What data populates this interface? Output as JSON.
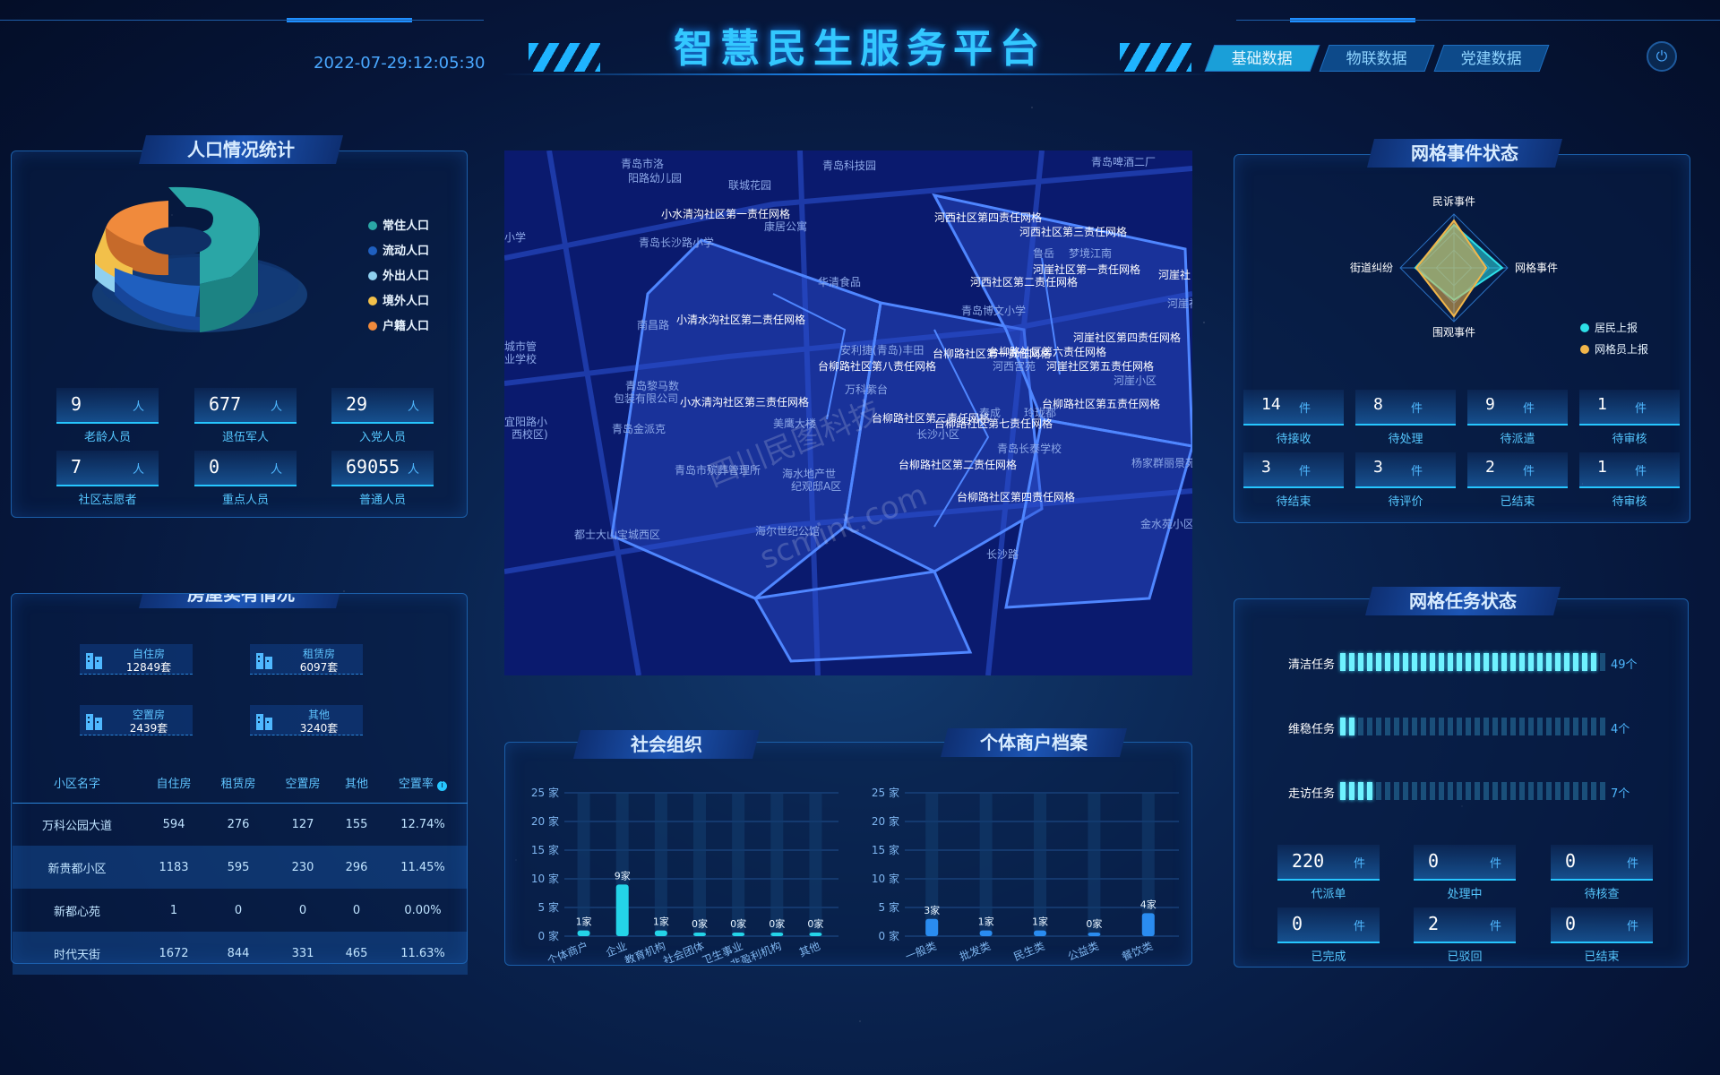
{
  "header": {
    "title": "智慧民生服务平台",
    "datetime": "2022-07-29:12:05:30",
    "tabs": [
      "基础数据",
      "物联数据",
      "党建数据"
    ],
    "power_icon": "power-icon"
  },
  "population": {
    "title": "人口情况统计",
    "legend": [
      {
        "label": "常住人口",
        "color": "#2aa6a6"
      },
      {
        "label": "流动人口",
        "color": "#1f5fbf"
      },
      {
        "label": "外出人口",
        "color": "#8fd0f0"
      },
      {
        "label": "境外人口",
        "color": "#f2c04a"
      },
      {
        "label": "户籍人口",
        "color": "#f08a3c"
      }
    ],
    "stats": [
      {
        "value": "9",
        "unit": "人",
        "label": "老龄人员"
      },
      {
        "value": "677",
        "unit": "人",
        "label": "退伍军人"
      },
      {
        "value": "29",
        "unit": "人",
        "label": "入党人员"
      },
      {
        "value": "7",
        "unit": "人",
        "label": "社区志愿者"
      },
      {
        "value": "0",
        "unit": "人",
        "label": "重点人员"
      },
      {
        "value": "69055",
        "unit": "人",
        "label": "普通人员"
      }
    ]
  },
  "housing": {
    "title": "房屋实有情况",
    "cards": [
      {
        "label": "自住房",
        "value": "12849套"
      },
      {
        "label": "租赁房",
        "value": "6097套"
      },
      {
        "label": "空置房",
        "value": "2439套"
      },
      {
        "label": "其他",
        "value": "3240套"
      }
    ],
    "table": {
      "headers": [
        "小区名字",
        "自住房",
        "租赁房",
        "空置房",
        "其他",
        "空置率"
      ],
      "rows": [
        [
          "万科公园大道",
          "594",
          "276",
          "127",
          "155",
          "12.74%"
        ],
        [
          "新贵都小区",
          "1183",
          "595",
          "230",
          "296",
          "11.45%"
        ],
        [
          "新都心苑",
          "1",
          "0",
          "0",
          "0",
          "0.00%"
        ],
        [
          "时代天街",
          "1672",
          "844",
          "331",
          "465",
          "11.63%"
        ]
      ]
    }
  },
  "map": {
    "labels": [
      "青岛市洛",
      "阳路幼儿园",
      "青岛科技园",
      "青岛啤酒二厂",
      "联城花园",
      "小水清沟社区第一责任网格",
      "康居公寓",
      "河西社区第四责任网格",
      "河西社区第三责任网格",
      "小学",
      "青岛长沙路小学",
      "鲁岳",
      "梦境江南",
      "河崖社区第一责任网格",
      "河崖社",
      "华清食品",
      "河西社区第二责任网格",
      "南昌路",
      "小清水沟社区第二责任网格",
      "青岛博文小学",
      "河崖社区",
      "城市管",
      "业学校",
      "台柳路社区第一责任网格",
      "台柳路社区第六责任网格",
      "河崖社区第四责任网格",
      "台柳路社区第八责任网格",
      "河西宫苑",
      "河崖社区第五责任网格",
      "安利捷(青岛)丰田",
      "青岛黎马数",
      "包装有限公司",
      "万科紫台",
      "河崖小区",
      "小水清沟社区第三责任网格",
      "台柳路社区第五责任网格",
      "宜阳路小",
      "西校区)",
      "青岛金派克",
      "美鹰大楼",
      "台柳路社区第三责任网格",
      "台柳路社区第七责任网格",
      "泰成",
      "玲珑都",
      "长沙小区",
      "青岛长泰学校",
      "杨家群丽景苑",
      "青岛市殡葬管理所",
      "台柳路社区第二责任网格",
      "海水地产世",
      "纪观邸A区",
      "台柳路社区第四责任网格",
      "都士大山宝城西区",
      "海尔世纪公馆",
      "金水苑小区",
      "长沙路",
      "四川民图科技",
      "scmint.com"
    ],
    "label_roles": [
      "poi",
      "poi",
      "poi",
      "poi",
      "poi",
      "grid",
      "poi",
      "grid",
      "grid",
      "poi",
      "poi",
      "poi",
      "poi",
      "grid",
      "grid",
      "poi",
      "grid",
      "poi",
      "grid",
      "poi",
      "poi",
      "poi",
      "poi",
      "grid",
      "grid",
      "grid",
      "grid",
      "poi",
      "grid",
      "poi",
      "poi",
      "poi",
      "poi",
      "poi",
      "grid",
      "grid",
      "poi",
      "poi",
      "poi",
      "poi",
      "grid",
      "grid",
      "poi",
      "poi",
      "poi",
      "poi",
      "poi",
      "poi",
      "grid",
      "poi",
      "poi",
      "grid",
      "poi",
      "poi",
      "poi",
      "poi",
      "watermark",
      "watermark"
    ]
  },
  "social_org": {
    "title": "社会组织",
    "chart_data": {
      "type": "bar",
      "categories": [
        "个体商户",
        "企业",
        "教育机构",
        "社会团体",
        "卫生事业",
        "非盈利机构",
        "其他"
      ],
      "values": [
        1,
        9,
        1,
        0,
        0,
        0,
        0
      ],
      "value_labels": [
        "1家",
        "9家",
        "1家",
        "0家",
        "0家",
        "0家",
        "0家"
      ],
      "yticks": [
        "0 家",
        "5 家",
        "10 家",
        "15 家",
        "20 家",
        "25 家"
      ],
      "ylim": [
        0,
        25
      ]
    }
  },
  "merchants": {
    "title": "个体商户档案",
    "chart_data": {
      "type": "bar",
      "categories": [
        "一般类",
        "批发类",
        "民生类",
        "公益类",
        "餐饮类"
      ],
      "values": [
        3,
        1,
        1,
        0,
        4
      ],
      "value_labels": [
        "3家",
        "1家",
        "1家",
        "0家",
        "4家"
      ],
      "yticks": [
        "0 家",
        "5 家",
        "10 家",
        "15 家",
        "20 家",
        "25 家"
      ],
      "ylim": [
        0,
        25
      ]
    }
  },
  "grid_events": {
    "title": "网格事件状态",
    "chart_data": {
      "type": "radar",
      "axes": [
        "民诉事件",
        "网格事件",
        "围观事件",
        "街道纠纷"
      ],
      "series": [
        {
          "name": "居民上报",
          "color": "#2de0e8",
          "values": [
            80,
            90,
            60,
            72
          ]
        },
        {
          "name": "网格员上报",
          "color": "#f2b64a",
          "values": [
            88,
            60,
            90,
            70
          ]
        }
      ]
    },
    "stats": [
      {
        "value": "14",
        "unit": "件",
        "label": "待接收"
      },
      {
        "value": "8",
        "unit": "件",
        "label": "待处理"
      },
      {
        "value": "9",
        "unit": "件",
        "label": "待派遣"
      },
      {
        "value": "1",
        "unit": "件",
        "label": "待审核"
      },
      {
        "value": "3",
        "unit": "件",
        "label": "待结束"
      },
      {
        "value": "3",
        "unit": "件",
        "label": "待评价"
      },
      {
        "value": "2",
        "unit": "件",
        "label": "已结束"
      },
      {
        "value": "1",
        "unit": "件",
        "label": "待审核"
      }
    ]
  },
  "grid_tasks": {
    "title": "网格任务状态",
    "tasks": [
      {
        "label": "清洁任务",
        "count": "49个",
        "fill": 0.98
      },
      {
        "label": "维稳任务",
        "count": "4个",
        "fill": 0.08
      },
      {
        "label": "走访任务",
        "count": "7个",
        "fill": 0.14
      }
    ],
    "stats": [
      {
        "value": "220",
        "unit": "件",
        "label": "代派单"
      },
      {
        "value": "0",
        "unit": "件",
        "label": "处理中"
      },
      {
        "value": "0",
        "unit": "件",
        "label": "待核查"
      },
      {
        "value": "0",
        "unit": "件",
        "label": "已完成"
      },
      {
        "value": "2",
        "unit": "件",
        "label": "已驳回"
      },
      {
        "value": "0",
        "unit": "件",
        "label": "已结束"
      }
    ]
  }
}
